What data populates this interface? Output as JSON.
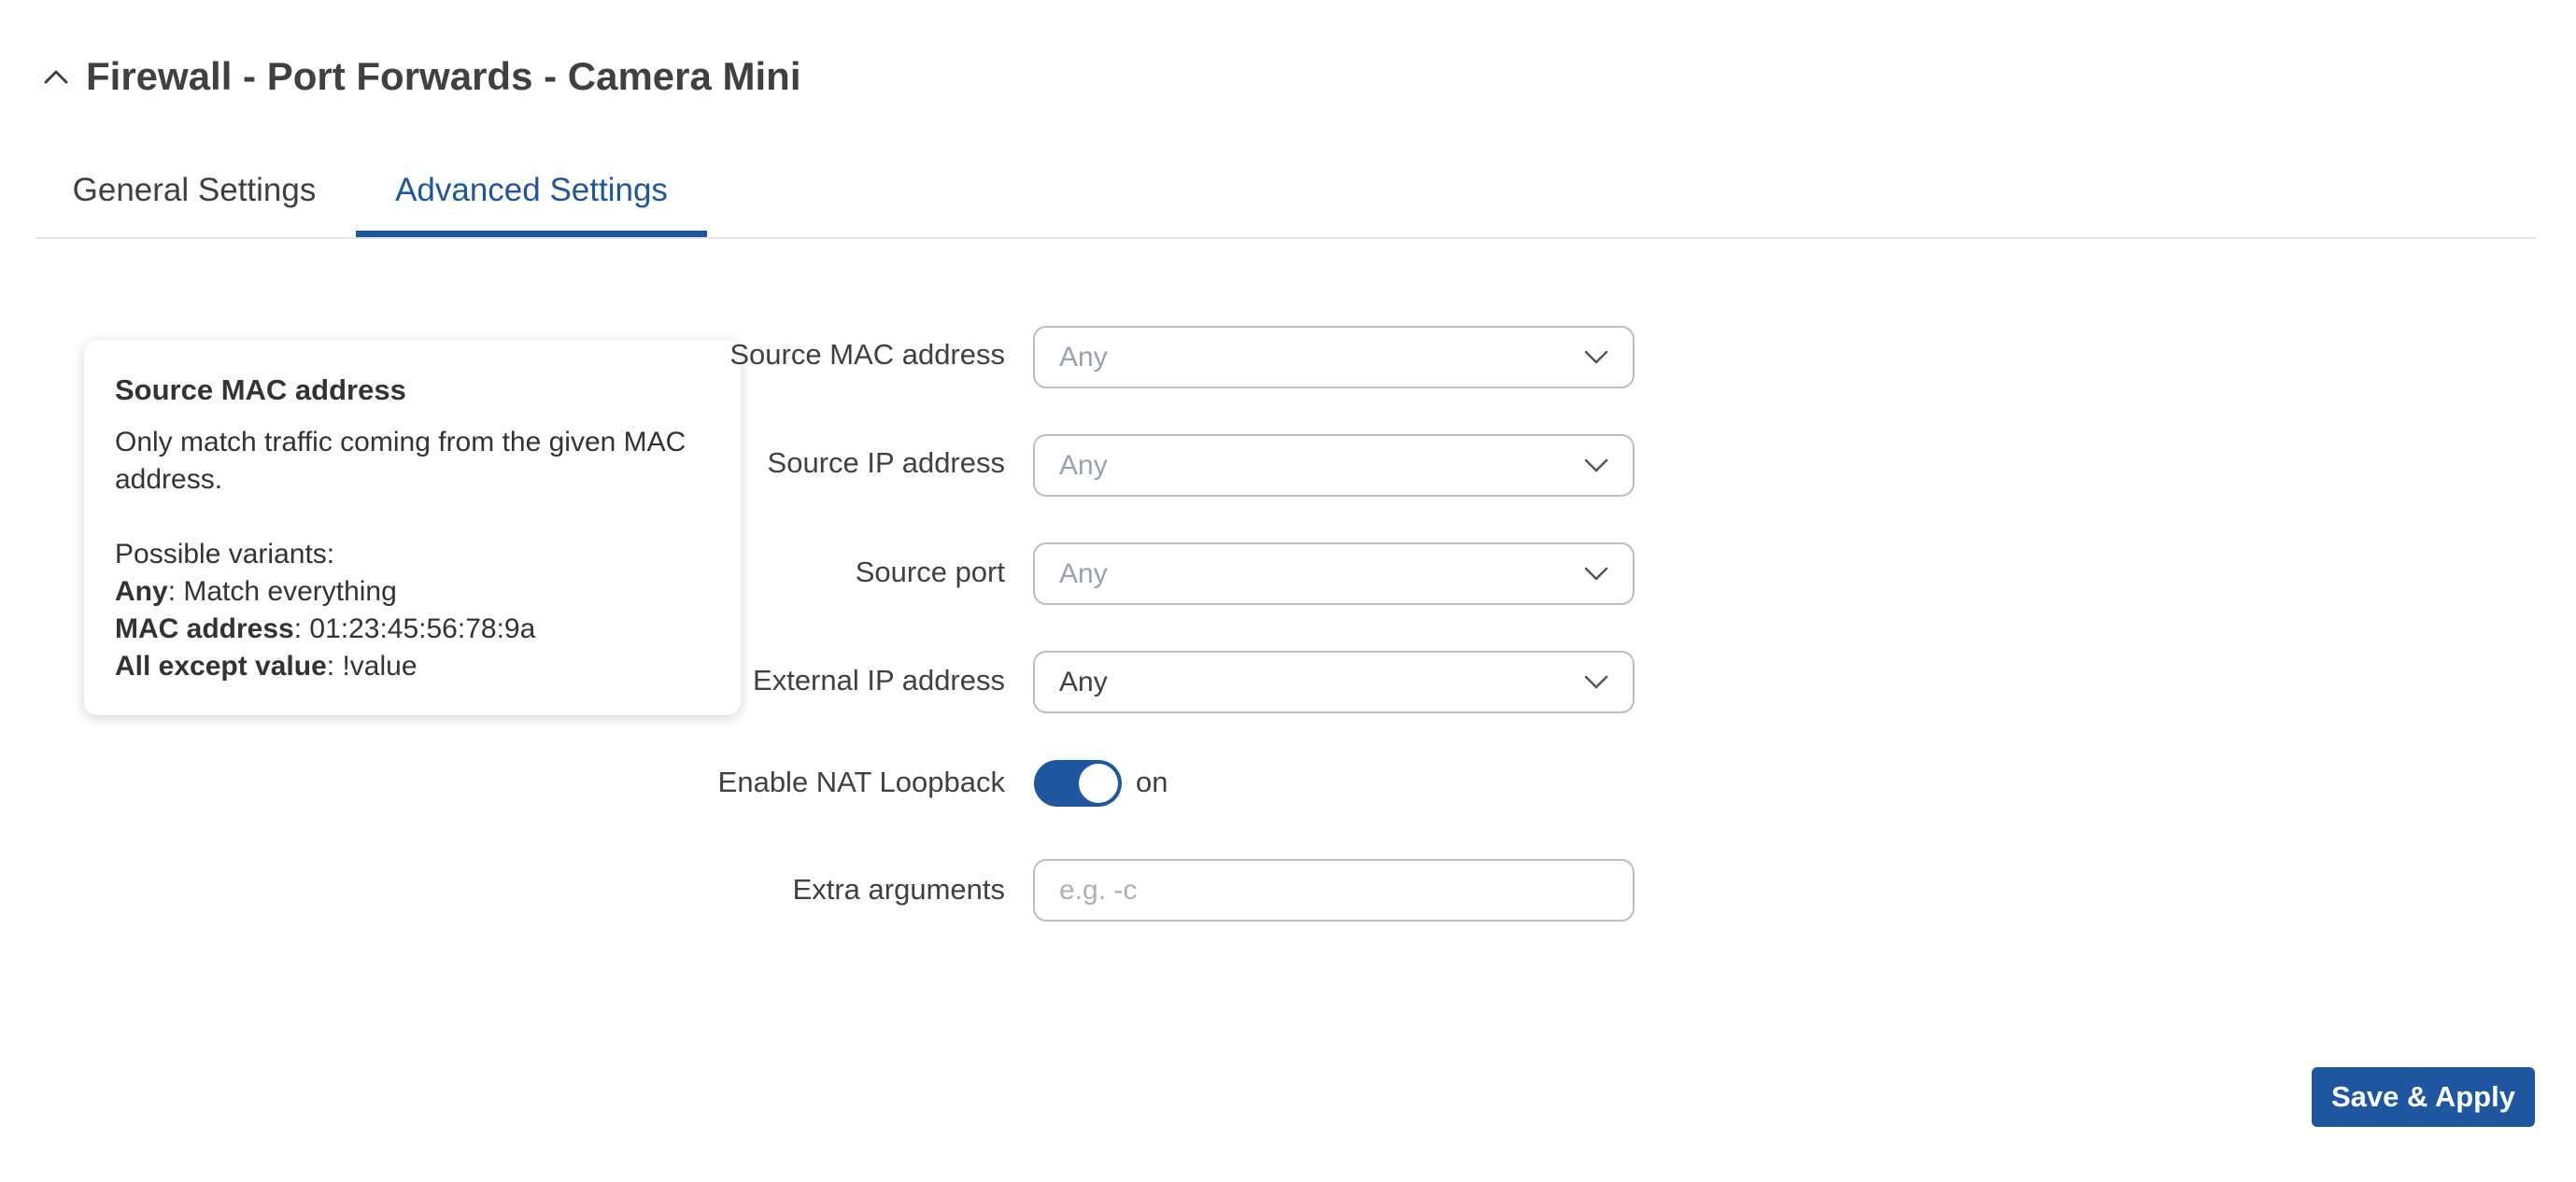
{
  "header": {
    "title": "Firewall - Port Forwards - Camera Mini",
    "collapse_icon": "chevron-up-icon"
  },
  "tabs": [
    {
      "label": "General Settings",
      "active": false
    },
    {
      "label": "Advanced Settings",
      "active": true
    }
  ],
  "help": {
    "title": "Source MAC address",
    "description": "Only match traffic coming from the given MAC address.",
    "variants_heading": "Possible variants:",
    "variants": [
      {
        "name": "Any",
        "value": ": Match everything"
      },
      {
        "name": "MAC address",
        "value": ": 01:23:45:56:78:9a"
      },
      {
        "name": "All except value",
        "value": ": !value"
      }
    ]
  },
  "form": {
    "source_mac": {
      "label": "Source MAC address",
      "value": "Any"
    },
    "source_ip": {
      "label": "Source IP address",
      "value": "Any"
    },
    "source_port": {
      "label": "Source port",
      "value": "Any"
    },
    "external_ip": {
      "label": "External IP address",
      "value": "Any"
    },
    "nat_loopback": {
      "label": "Enable NAT Loopback",
      "state": "on"
    },
    "extra_args": {
      "label": "Extra arguments",
      "placeholder": "e.g. -c",
      "value": ""
    }
  },
  "actions": {
    "save_label": "Save & Apply"
  },
  "colors": {
    "accent": "#1e56a0",
    "text": "#404040",
    "border": "#bdbdbd",
    "placeholder": "#9aa3ad"
  }
}
